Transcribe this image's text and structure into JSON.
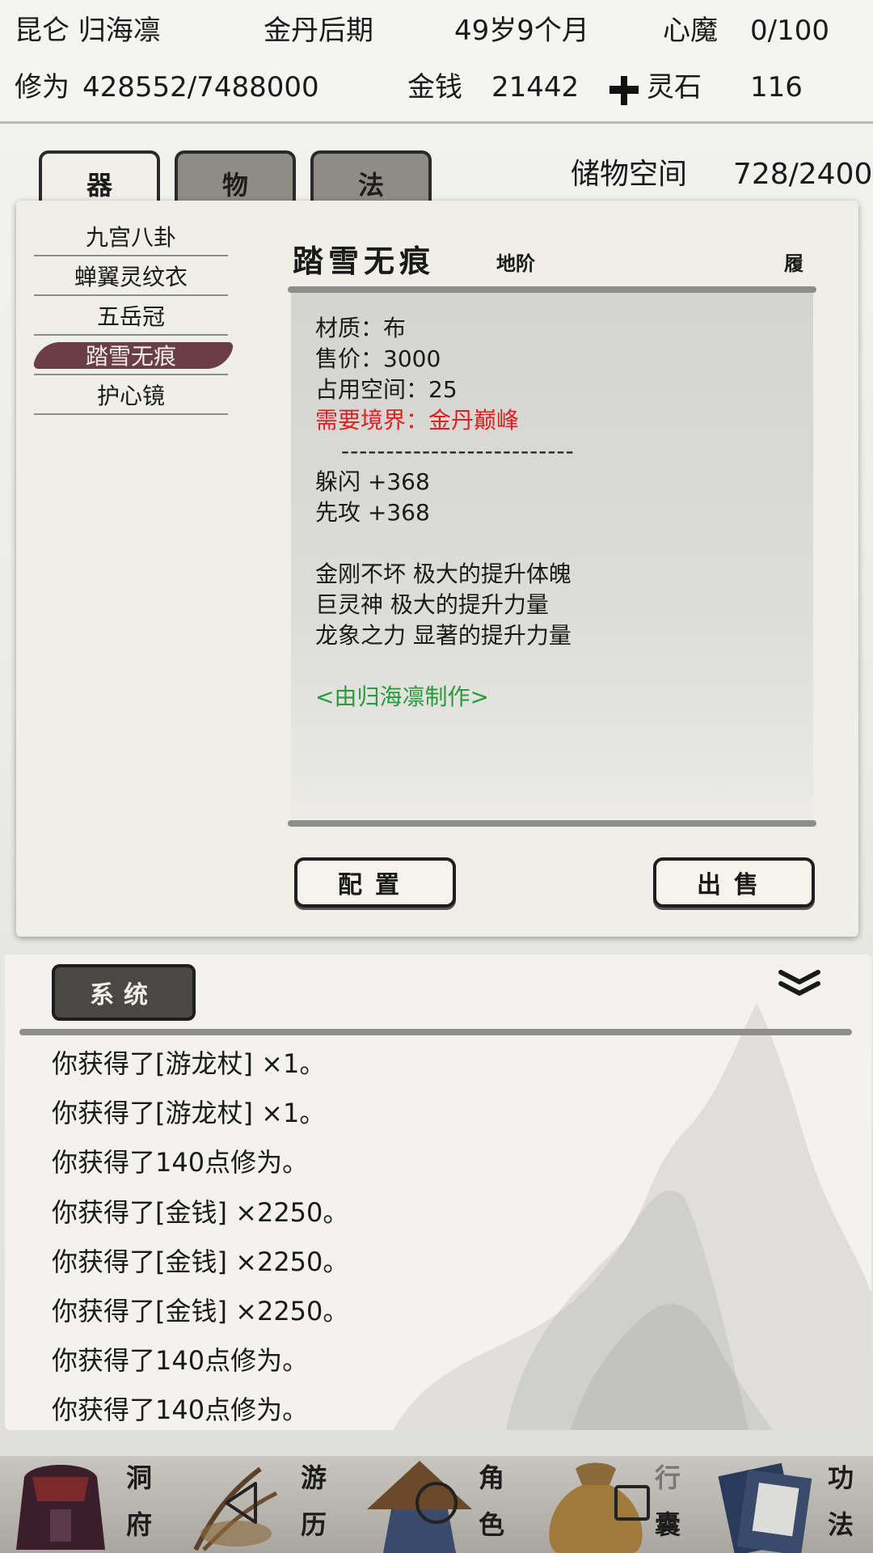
{
  "status": {
    "sect_name": "昆仑 归海凛",
    "realm": "金丹后期",
    "age": "49岁9个月",
    "heart_demon_label": "心魔",
    "heart_demon_value": "0/100",
    "cultivation_label": "修为",
    "cultivation_value": "428552/7488000",
    "money_label": "金钱",
    "money_value": "21442",
    "spirit_stone_icon": "spirit-stone-icon",
    "spirit_stone_label": "灵石",
    "spirit_stone_value": "116"
  },
  "tabs": [
    {
      "label": "器",
      "active": true
    },
    {
      "label": "物",
      "active": false
    },
    {
      "label": "法",
      "active": false
    }
  ],
  "storage": {
    "label": "储物空间",
    "value": "728/2400"
  },
  "items": [
    {
      "name": "九宫八卦"
    },
    {
      "name": "蝉翼灵纹衣"
    },
    {
      "name": "五岳冠"
    },
    {
      "name": "踏雪无痕",
      "selected": true
    },
    {
      "name": "护心镜"
    }
  ],
  "detail": {
    "title": "踏雪无痕",
    "grade": "地阶",
    "slot": "履",
    "material": "材质：布",
    "price": "售价：3000",
    "space": "占用空间：25",
    "requirement": "需要境界：金丹巅峰",
    "divider": "--------------------------",
    "stats": [
      "躲闪 +368",
      "先攻 +368"
    ],
    "effects": [
      "金刚不坏 极大的提升体魄",
      "巨灵神 极大的提升力量",
      "龙象之力 显著的提升力量"
    ],
    "maker": "<由归海凛制作>"
  },
  "buttons": {
    "equip": "配置",
    "sell": "出售"
  },
  "log": {
    "tab_label": "系统",
    "collapse_icon": "double-chevron-down-icon",
    "lines": [
      "你获得了[游龙杖] ×1。",
      "你获得了[游龙杖] ×1。",
      "你获得了140点修为。",
      "你获得了[金钱] ×2250。",
      "你获得了[金钱] ×2250。",
      "你获得了[金钱] ×2250。",
      "你获得了140点修为。",
      "你获得了140点修为。"
    ]
  },
  "nav": [
    {
      "label_1": "洞",
      "label_2": "府",
      "icon": "cave-residence-icon"
    },
    {
      "label_1": "游",
      "label_2": "历",
      "icon": "travel-icon"
    },
    {
      "label_1": "角",
      "label_2": "色",
      "icon": "character-icon"
    },
    {
      "label_1": "行",
      "label_2": "囊",
      "icon": "bag-icon"
    },
    {
      "label_1": "功",
      "label_2": "法",
      "icon": "technique-icon"
    }
  ],
  "system_nav": {
    "back": "back-triangle-icon",
    "home": "home-circle-icon",
    "recents": "recents-square-icon"
  },
  "colors": {
    "requirement": "#e02020",
    "maker": "#2a9a3a",
    "selected_item": "#6b3d47",
    "log_tab": "#4a4845"
  }
}
